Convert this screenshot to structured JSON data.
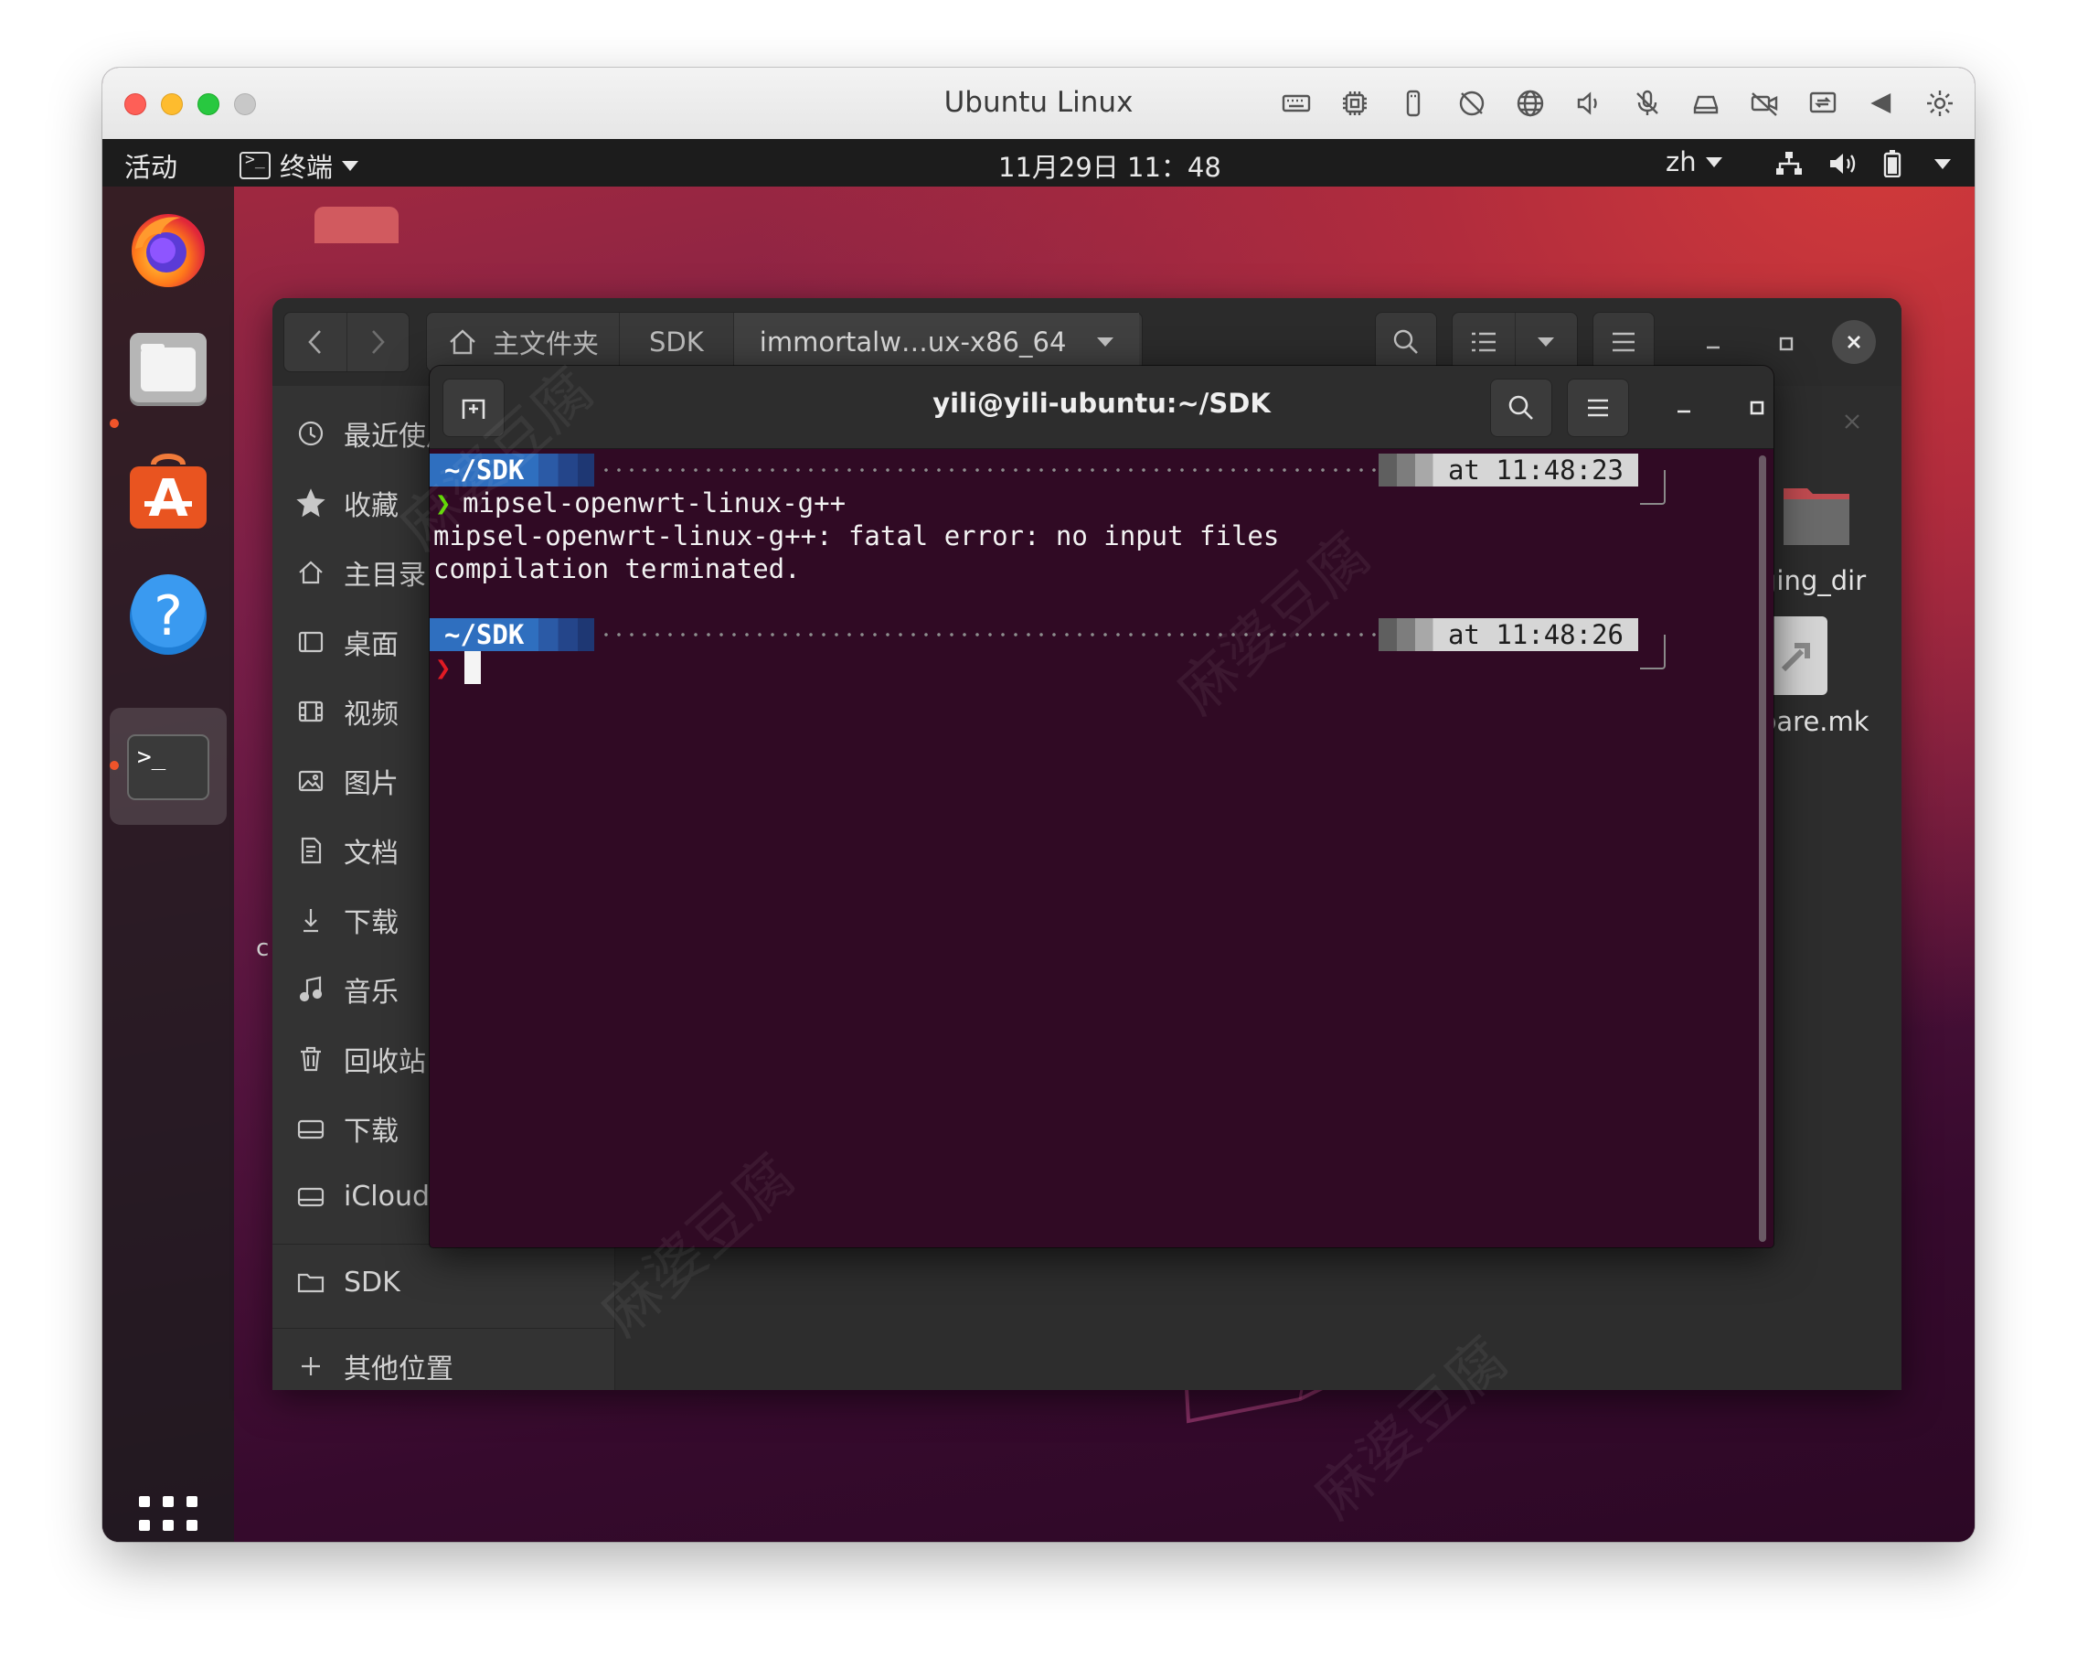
{
  "vm": {
    "title": "Ubuntu Linux",
    "toolbar_icons": [
      "keyboard-icon",
      "cpu-icon",
      "usb-icon",
      "camera-off-icon",
      "globe-icon",
      "speaker-icon",
      "mic-icon",
      "disk-icon",
      "video-off-icon",
      "share-screen-icon",
      "back-arrow-icon",
      "gear-icon"
    ]
  },
  "topbar": {
    "activities": "活动",
    "app_name": "终端",
    "clock": "11月29日  11：48",
    "lang": "zh"
  },
  "dock": {
    "apps": [
      "Firefox",
      "文件",
      "Ubuntu Software",
      "帮助",
      "终端"
    ]
  },
  "files": {
    "breadcrumbs": [
      "主文件夹",
      "SDK",
      "immortalw…ux-x86_64"
    ],
    "sidebar": [
      {
        "label": "最近使用",
        "icon": "clock-icon"
      },
      {
        "label": "收藏",
        "icon": "star-icon"
      },
      {
        "label": "主目录",
        "icon": "home-icon"
      },
      {
        "label": "桌面",
        "icon": "desktop-icon"
      },
      {
        "label": "视频",
        "icon": "film-icon"
      },
      {
        "label": "图片",
        "icon": "image-icon"
      },
      {
        "label": "文档",
        "icon": "document-icon"
      },
      {
        "label": "下载",
        "icon": "download-icon"
      },
      {
        "label": "音乐",
        "icon": "music-icon"
      },
      {
        "label": "回收站",
        "icon": "trash-icon"
      },
      {
        "label": "下载",
        "icon": "drive-icon"
      },
      {
        "label": "iCloud",
        "icon": "drive-icon"
      },
      {
        "label": "SDK",
        "icon": "folder-icon"
      },
      {
        "label": "其他位置",
        "icon": "plus-icon"
      }
    ],
    "visible_files": [
      "ging_dir",
      "pare.mk"
    ],
    "desktop_fragment": "c"
  },
  "terminal": {
    "title": "yili@yili-ubuntu:~/SDK",
    "prompt_dir": "~/SDK",
    "prompt1_time": "at 11:48:23",
    "prompt2_time": "at 11:48:26",
    "chevron": "❯",
    "command": "mipsel-openwrt-linux-g++",
    "output": [
      "mipsel-openwrt-linux-g++: fatal error: no input files",
      "compilation terminated."
    ],
    "colors": {
      "ok_chevron": "#5fd700",
      "err_chevron": "#e01b24",
      "bg": "#300a24"
    }
  },
  "watermark": "麻婆豆腐"
}
